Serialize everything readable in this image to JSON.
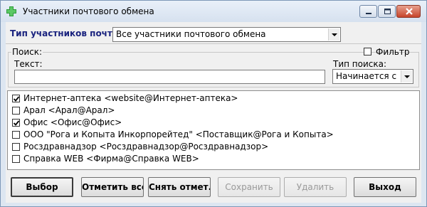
{
  "window": {
    "title": "Участники почтового обмена"
  },
  "participant_type": {
    "label": "Тип участников почты",
    "value": "Все участники почтового обмена"
  },
  "search": {
    "group_label": "Поиск:",
    "filter_label": "Фильтр",
    "filter_checked": false,
    "text_label": "Текст:",
    "text_value": "",
    "search_type_label": "Тип поиска:",
    "search_type_value": "Начинается с"
  },
  "participants": [
    {
      "label": "Интернет-аптека <website@Интернет-аптека>",
      "checked": true
    },
    {
      "label": "Арал <Арал@Арал>",
      "checked": false
    },
    {
      "label": "Офис <Офис@Офис>",
      "checked": true
    },
    {
      "label": "ООО \"Рога и Копыта Инкорпорейтед\" <Поставщик@Рога и Копыта>",
      "checked": false
    },
    {
      "label": "Росздравнадзор <Росздравнадзор@Росздравнадзор>",
      "checked": false
    },
    {
      "label": "Справка WEB <Фирма@Справка WEB>",
      "checked": false
    }
  ],
  "buttons": {
    "select": "Выбор",
    "mark_all": "Отметить все",
    "unmark": "Снять отмет.",
    "save": "Сохранить",
    "delete": "Удалить",
    "exit": "Выход"
  },
  "icons": {
    "app": "green-cross-icon",
    "minimize": "minimize-icon",
    "maximize": "maximize-icon",
    "close": "close-icon"
  }
}
